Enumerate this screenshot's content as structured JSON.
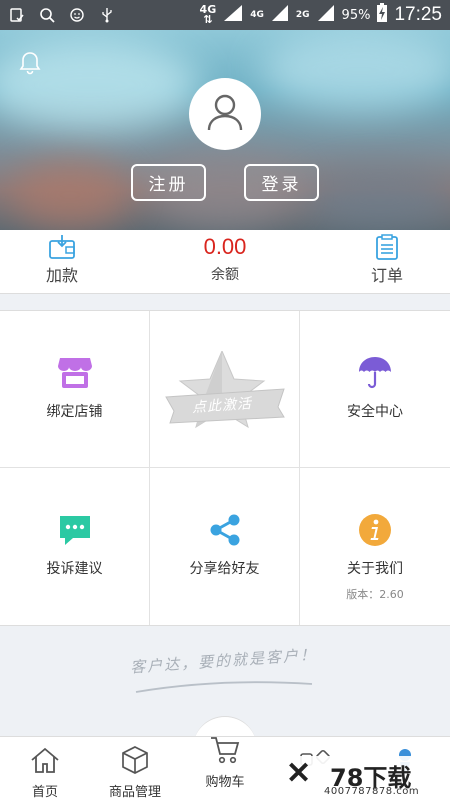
{
  "status_bar": {
    "net1": "4G",
    "net2": "4G",
    "net3": "2G",
    "battery": "95%",
    "time": "17:25",
    "icons": [
      "notification-icon",
      "search-icon",
      "face-icon",
      "usb-icon"
    ]
  },
  "hero": {
    "register_label": "注册",
    "login_label": "登录",
    "icons": [
      "bell-icon",
      "avatar-icon"
    ]
  },
  "account": {
    "recharge_label": "加款",
    "balance_value": "0.00",
    "balance_label": "余额",
    "orders_label": "订单"
  },
  "grid": {
    "bind_store": "绑定店铺",
    "activate_badge": "点此激活",
    "security_center": "安全中心",
    "complaints": "投诉建议",
    "share_friends": "分享给好友",
    "about_us": "关于我们",
    "version": "版本：2.60"
  },
  "slogan": "客户达，要的就是客户！",
  "tabbar": {
    "home": "首页",
    "goods": "商品管理",
    "cart": "购物车"
  },
  "watermark": {
    "logo": "78下载",
    "number": "4007787878.com"
  },
  "colors": {
    "balance": "#d9251e",
    "store_icon": "#c070e6",
    "security_icon": "#7b5cd6",
    "complaints_icon": "#2bc9a3",
    "share_icon": "#3aa3e0",
    "about_icon": "#f2a93b"
  }
}
